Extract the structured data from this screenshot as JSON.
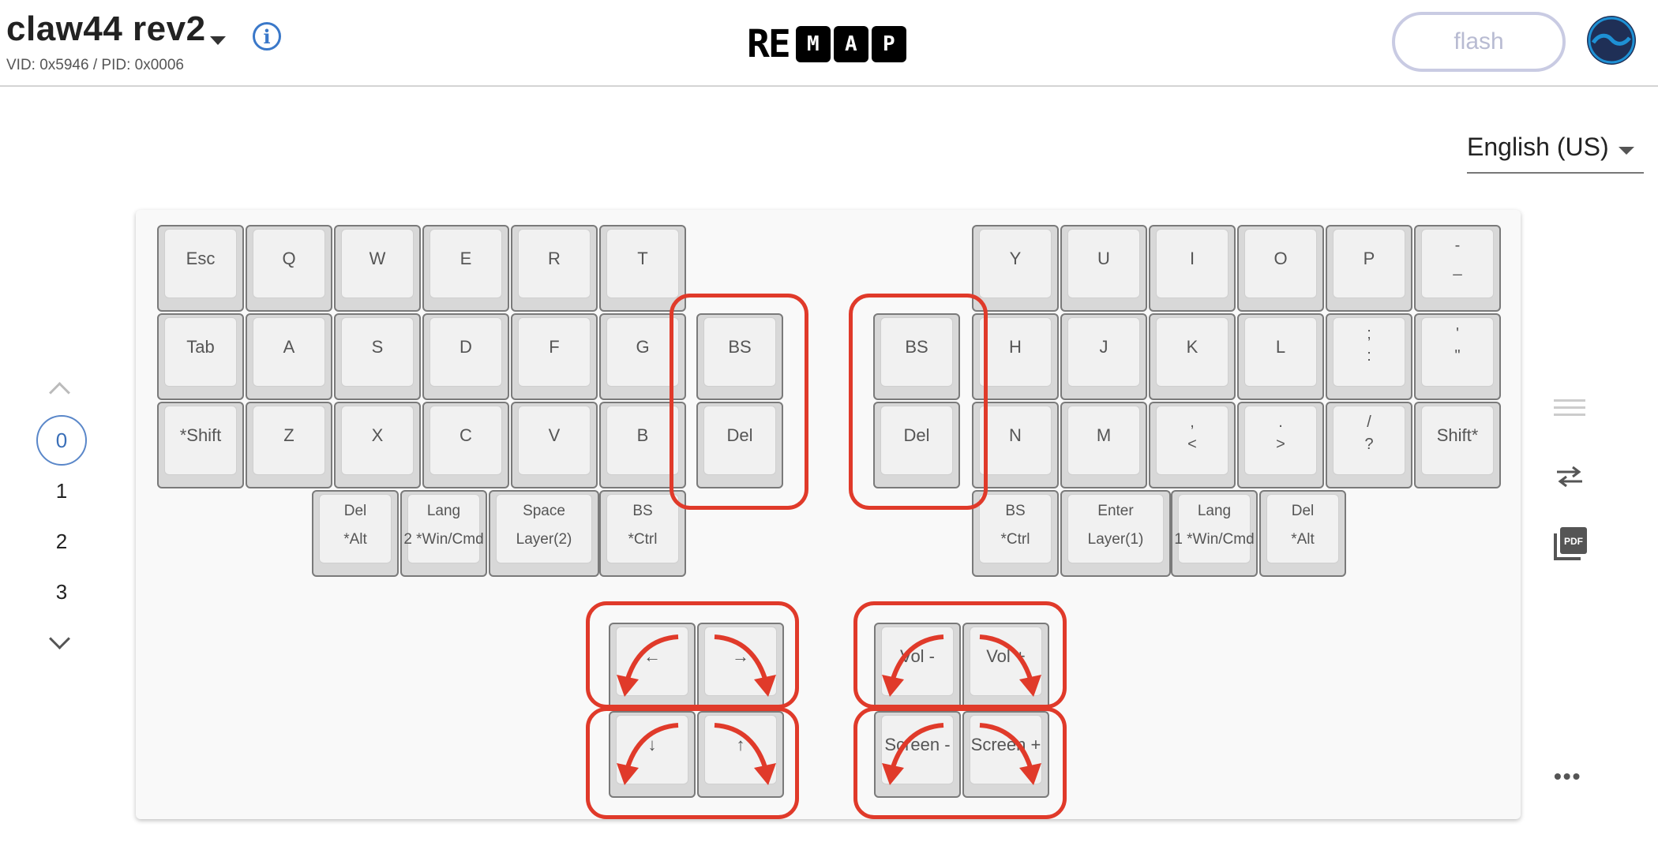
{
  "header": {
    "keyboard_name": "claw44 rev2",
    "vid_pid": "VID: 0x5946 / PID: 0x0006",
    "logo": {
      "plain": "RE",
      "boxed": [
        "M",
        "A",
        "P"
      ]
    },
    "flash_label": "flash"
  },
  "language": {
    "selected": "English (US)"
  },
  "layers": {
    "items": [
      "0",
      "1",
      "2",
      "3"
    ],
    "selected": "0"
  },
  "keyboard": {
    "rows": [
      [
        "Esc",
        "Q",
        "W",
        "E",
        "R",
        "T",
        "Y",
        "U",
        "I",
        "O",
        "P",
        "_ -"
      ],
      [
        "Tab",
        "A",
        "S",
        "D",
        "F",
        "G",
        "BS",
        "BS",
        "H",
        "J",
        "K",
        "L",
        ": ;",
        "\" '"
      ],
      [
        "*Shift",
        "Z",
        "X",
        "C",
        "V",
        "B",
        "Del",
        "Del",
        "N",
        "M",
        "< ,",
        "> .",
        "? /",
        "Shift*"
      ],
      [
        "Del *Alt",
        "Lang 2 *Win/Cmd",
        "Space Layer(2)",
        "BS *Ctrl",
        "BS *Ctrl",
        "Enter Layer(1)",
        "Lang 1 *Win/Cmd",
        "Del *Alt"
      ]
    ],
    "encoder_keys": {
      "left": [
        "←",
        "→",
        "↓",
        "↑"
      ],
      "right": [
        "Vol -",
        "Vol +",
        "Screen -",
        "Screen +"
      ]
    }
  },
  "colors": {
    "highlight": "#e03a2a",
    "accent": "#3a78c9"
  }
}
